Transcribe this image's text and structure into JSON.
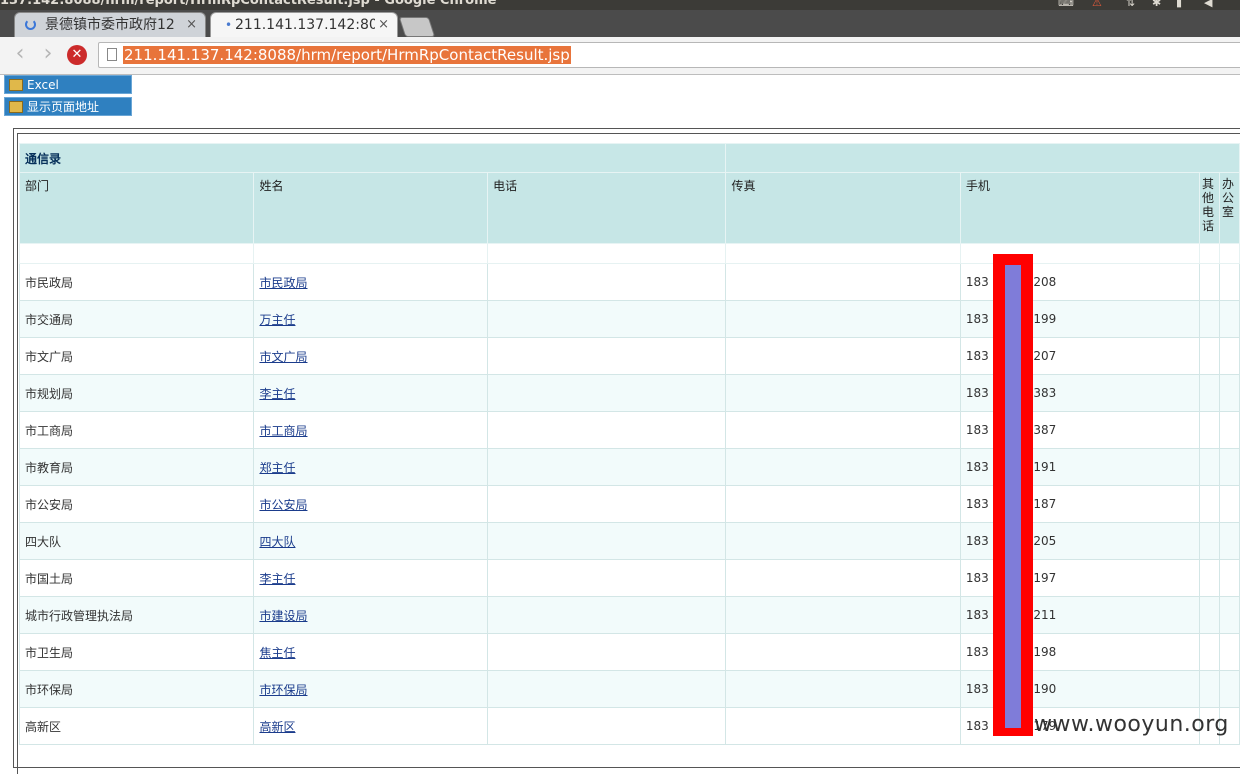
{
  "window": {
    "title": "137.142:8088/hrm/report/HrmRpContactResult.jsp - Google Chrome"
  },
  "tabs": [
    {
      "label": "景德镇市委市政府12",
      "loading": true
    },
    {
      "label": "211.141.137.142:808",
      "active": true
    }
  ],
  "toolbar": {
    "url": "211.141.137.142:8088/hrm/report/HrmRpContactResult.jsp"
  },
  "page_buttons": {
    "excel": "Excel",
    "show_address": "显示页面地址"
  },
  "report": {
    "title": "通信录",
    "columns": [
      "部门",
      "姓名",
      "电话",
      "传真",
      "手机",
      "其他电话",
      "办公室"
    ],
    "rows": [
      {
        "dept": "市民政局",
        "name": "市民政局",
        "phone_prefix": "183",
        "phone_suffix": "0208"
      },
      {
        "dept": "市交通局",
        "name": "万主任",
        "phone_prefix": "183",
        "phone_suffix": "0199"
      },
      {
        "dept": "市文广局",
        "name": "市文广局",
        "phone_prefix": "183",
        "phone_suffix": "0207"
      },
      {
        "dept": "市规划局",
        "name": "李主任",
        "phone_prefix": "183",
        "phone_suffix": "0383"
      },
      {
        "dept": "市工商局",
        "name": "市工商局",
        "phone_prefix": "183",
        "phone_suffix": "0387"
      },
      {
        "dept": "市教育局",
        "name": "郑主任",
        "phone_prefix": "183",
        "phone_suffix": "0191"
      },
      {
        "dept": "市公安局",
        "name": "市公安局",
        "phone_prefix": "183",
        "phone_suffix": "0187"
      },
      {
        "dept": "四大队",
        "name": "四大队",
        "phone_prefix": "183",
        "phone_suffix": "0205"
      },
      {
        "dept": "市国土局",
        "name": "李主任",
        "phone_prefix": "183",
        "phone_suffix": "0197"
      },
      {
        "dept": "城市行政管理执法局",
        "name": "市建设局",
        "phone_prefix": "183",
        "phone_suffix": "0211"
      },
      {
        "dept": "市卫生局",
        "name": "焦主任",
        "phone_prefix": "183",
        "phone_suffix": "0198"
      },
      {
        "dept": "市环保局",
        "name": "市环保局",
        "phone_prefix": "183",
        "phone_suffix": "0190"
      },
      {
        "dept": "高新区",
        "name": "高新区",
        "phone_prefix": "183",
        "phone_suffix": "0179"
      }
    ]
  },
  "watermark": "www.wooyun.org"
}
